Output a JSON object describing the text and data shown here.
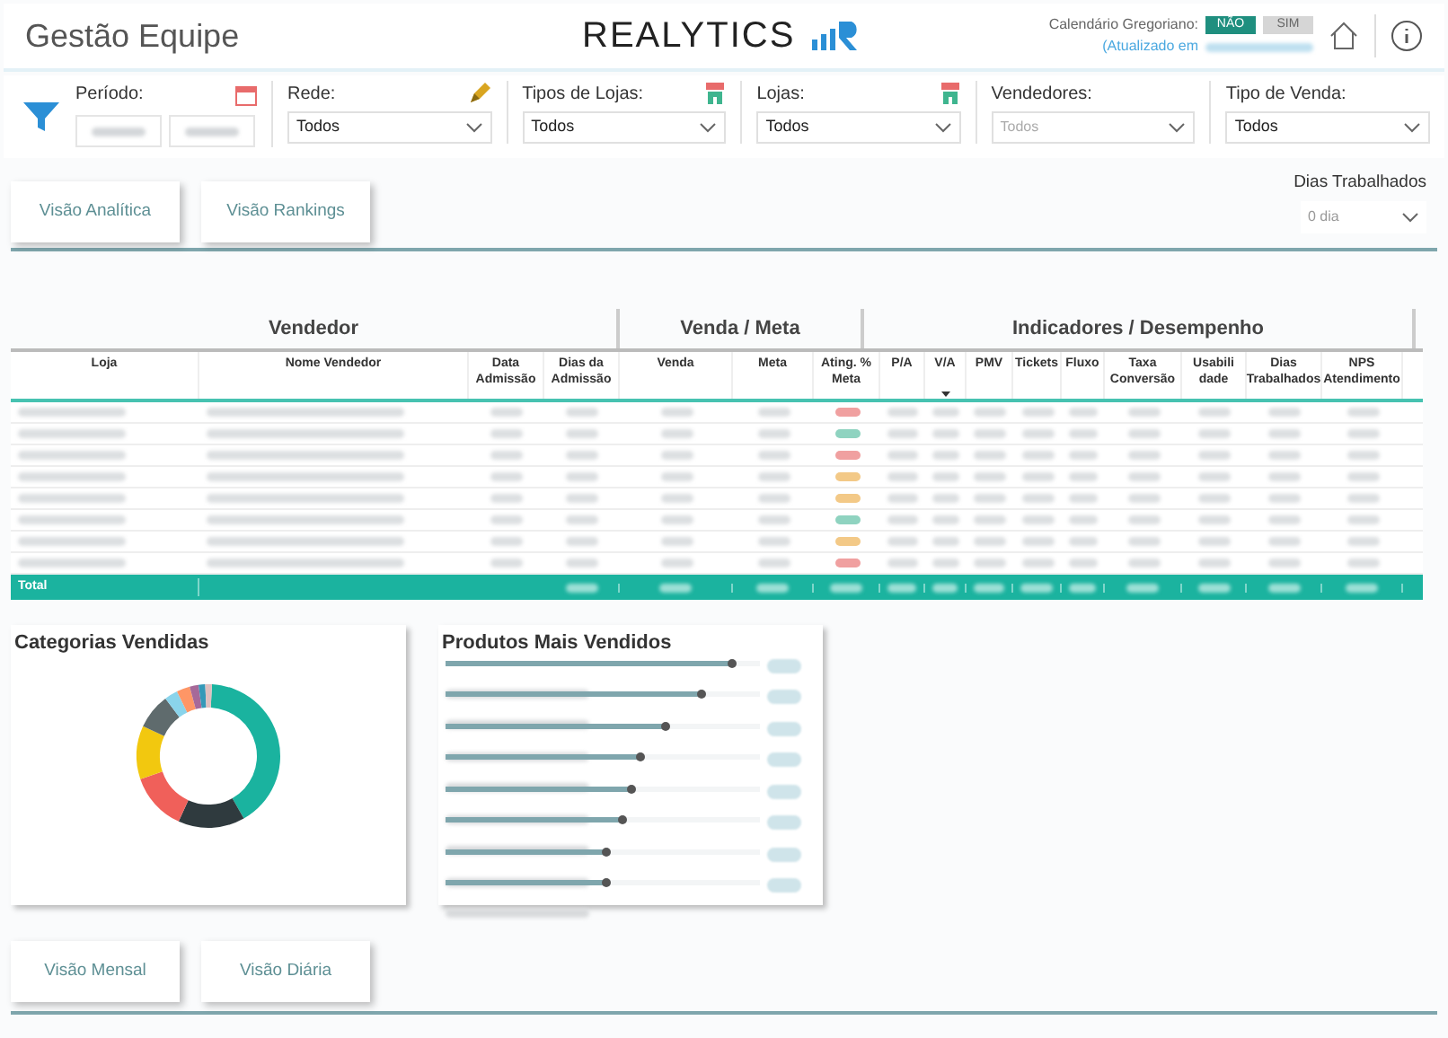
{
  "header": {
    "title": "Gestão Equipe",
    "logo_text": "REALYTICS",
    "calendar_label": "Calendário Gregoriano:",
    "calendar_options": [
      {
        "label": "NÃO",
        "selected": true
      },
      {
        "label": "SIM",
        "selected": false
      }
    ],
    "updated_prefix": "(Atualizado em"
  },
  "filters": [
    {
      "kind": "date",
      "label": "Período:"
    },
    {
      "kind": "dropdown",
      "label": "Rede:",
      "value": "Todos",
      "disabled": false
    },
    {
      "kind": "dropdown",
      "label": "Tipos de Lojas:",
      "value": "Todos",
      "disabled": false
    },
    {
      "kind": "dropdown",
      "label": "Lojas:",
      "value": "Todos",
      "disabled": false
    },
    {
      "kind": "dropdown",
      "label": "Vendedores:",
      "value": "Todos",
      "disabled": true
    },
    {
      "kind": "dropdown",
      "label": "Tipo de Venda:",
      "value": "Todos",
      "disabled": false
    }
  ],
  "top_tabs": [
    "Visão Analítica",
    "Visão Rankings"
  ],
  "dias_trabalhados": {
    "label": "Dias Trabalhados",
    "placeholder": "0 dia"
  },
  "table": {
    "groups": [
      "Vendedor",
      "Venda / Meta",
      "Indicadores / Desempenho"
    ],
    "columns": [
      "Loja",
      "Nome Vendedor",
      "Data Admissão",
      "Dias da Admissão",
      "Venda",
      "Meta",
      "Ating. % Meta",
      "P/A",
      "V/A",
      "PMV",
      "Tickets",
      "Fluxo",
      "Taxa Conversão",
      "Usabili dade",
      "Dias Trabalhados",
      "NPS Atendimento"
    ],
    "rows": [
      {
        "color": "#f0a0a0"
      },
      {
        "color": "#8fd3c0"
      },
      {
        "color": "#f0a0a0"
      },
      {
        "color": "#f3c987"
      },
      {
        "color": "#f3c987"
      },
      {
        "color": "#8fd3c0"
      },
      {
        "color": "#f3c987"
      },
      {
        "color": "#f0a0a0"
      }
    ],
    "total_label": "Total"
  },
  "categorias": {
    "title": "Categorias Vendidas"
  },
  "produtos": {
    "title": "Produtos Mais Vendidos",
    "bars": [
      {
        "level": 0.92
      },
      {
        "level": 0.82
      },
      {
        "level": 0.71
      },
      {
        "level": 0.63
      },
      {
        "level": 0.6
      },
      {
        "level": 0.57
      },
      {
        "level": 0.52
      },
      {
        "level": 0.52
      }
    ]
  },
  "bottom_tabs": [
    "Visão Mensal",
    "Visão Diária"
  ]
}
